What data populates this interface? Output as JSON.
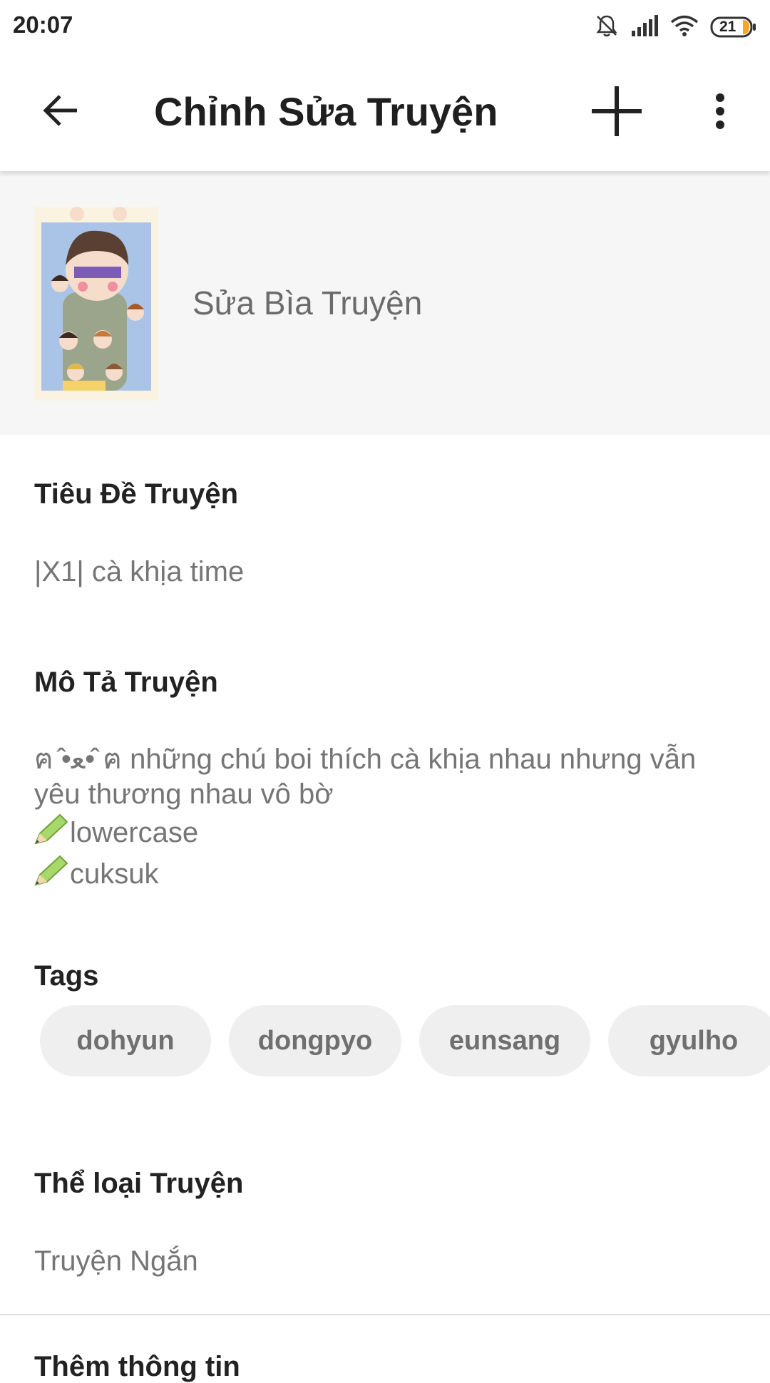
{
  "status_bar": {
    "time": "20:07",
    "battery": "21",
    "icons": [
      "bell-off-icon",
      "signal-icon",
      "wifi-icon",
      "battery-icon"
    ]
  },
  "app_bar": {
    "title": "Chỉnh Sửa Truyện",
    "icons": [
      "back-arrow-icon",
      "plus-icon",
      "more-vert-icon"
    ]
  },
  "cover": {
    "label": "Sửa Bìa Truyện"
  },
  "story_title": {
    "label": "Tiêu Đề Truyện",
    "value": "|X1| cà khịa time"
  },
  "description": {
    "label": "Mô Tả Truyện",
    "lines": [
      "ฅ ̂•ﻌ• ̂ฅ những chú boi thích cà khịa nhau nhưng vẫn",
      "yêu thương nhau vô bờ",
      "lowercase",
      "cuksuk"
    ],
    "line_icon": "pencil-icon"
  },
  "tags": {
    "label": "Tags",
    "items": [
      "dohyun",
      "dongpyo",
      "eunsang",
      "gyulho"
    ]
  },
  "category": {
    "label": "Thể loại Truyện",
    "value": "Truyện Ngắn"
  },
  "more_info": {
    "label": "Thêm thông tin"
  },
  "colors": {
    "accent_text": "#222222",
    "secondary_text": "#757575",
    "chip_bg": "#efefef",
    "cover_bg": "#f6f6f6"
  }
}
